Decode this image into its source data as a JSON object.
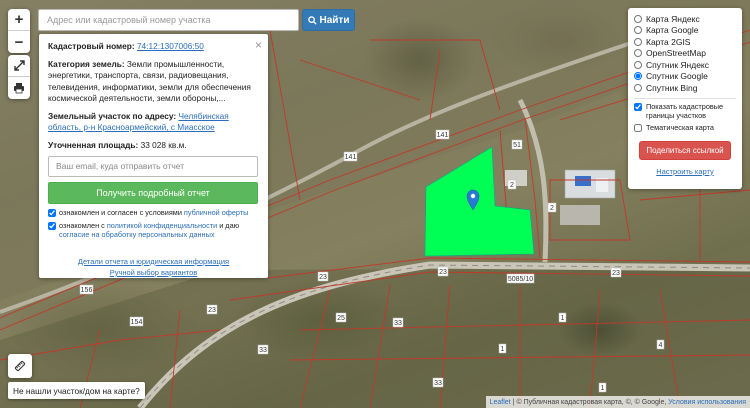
{
  "search": {
    "placeholder": "Адрес или кадастровый номер участка",
    "button_label": "Найти",
    "button_icon": "search-icon"
  },
  "map_controls": {
    "zoom_in": "+",
    "zoom_out": "−",
    "fullscreen_icon": "expand-icon",
    "print_icon": "print-icon",
    "ruler_icon": "ruler-icon"
  },
  "info_panel": {
    "close": "×",
    "cadastral_label": "Кадастровый номер:",
    "cadastral_number": "74:12:1307006:50",
    "category_label": "Категория земель:",
    "category_value": "Земли промышленности, энергетики, транспорта, связи, радиовещания, телевидения, информатики, земли для обеспечения космической деятельности, земли обороны,...",
    "address_label": "Земельный участок по адресу:",
    "address_value": "Челябинская область, р-н Красноармейский, с Миасское",
    "area_label": "Уточненная площадь:",
    "area_value": "33 028 кв.м.",
    "email_placeholder": "Ваш email, куда отправить отчет",
    "report_button": "Получить подробный отчет",
    "agree1_text": "ознакомлен и согласен с условиями",
    "agree1_link": "публичной оферты",
    "agree2_text_a": "ознакомлен с",
    "agree2_link_a": "политикой конфиденциальности",
    "agree2_text_b": "и даю",
    "agree2_link_b": "согласие на обработку персональных данных",
    "details_link": "Детали отчета и юридическая информация",
    "manual_link": "Ручной выбор вариантов"
  },
  "layers": {
    "options": [
      {
        "label": "Карта Яндекс",
        "selected": false
      },
      {
        "label": "Карта Google",
        "selected": false
      },
      {
        "label": "Карта 2GIS",
        "selected": false
      },
      {
        "label": "OpenStreetMap",
        "selected": false
      },
      {
        "label": "Спутник Яндекс",
        "selected": false
      },
      {
        "label": "Спутник Google",
        "selected": true
      },
      {
        "label": "Спутник Bing",
        "selected": false
      }
    ],
    "show_boundaries_label": "Показать кадастровые границы участков",
    "show_boundaries_checked": true,
    "thematic_label": "Тематическая карта",
    "thematic_checked": false,
    "share_button": "Поделиться ссылкой",
    "configure_link": "Настроить карту"
  },
  "bottom": {
    "not_found_label": "Не нашли участок/дом на карте?"
  },
  "attribution": {
    "leaflet": "Leaflet",
    "sep": "|",
    "text": "© Публичная кадастровая карта, ©, © Google,",
    "terms": "Условия использования"
  },
  "map_labels": {
    "plot_numbers": [
      "141",
      "141",
      "51",
      "2",
      "2",
      "23",
      "23",
      "23",
      "23",
      "5085/10",
      "154",
      "156",
      "25",
      "33",
      "33",
      "33",
      "1",
      "1",
      "1",
      "4"
    ]
  },
  "colors": {
    "selected_parcel": "#00ff55",
    "boundary": "#c0392b",
    "marker": "#2a7ad3",
    "search_button": "#337ab7",
    "report_button": "#5cb85c",
    "share_button": "#d9534f"
  }
}
